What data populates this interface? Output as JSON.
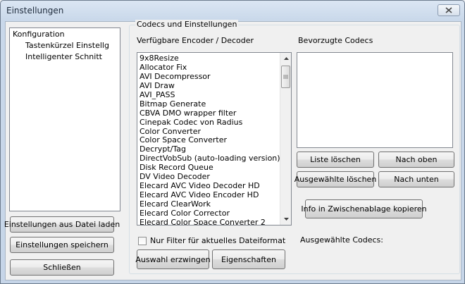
{
  "window": {
    "title": "Einstellungen"
  },
  "icons": {
    "close": "close-icon",
    "scroll_up": "arrow-up-icon",
    "scroll_down": "arrow-down-icon",
    "grip": "scroll-grip-icon"
  },
  "sidebar": {
    "items": [
      {
        "label": "Konfiguration",
        "level": 0
      },
      {
        "label": "Tastenkürzel Einstellg",
        "level": 1
      },
      {
        "label": "Intelligenter Schnitt",
        "level": 1
      }
    ],
    "load_button": "Einstellungen aus Datei laden",
    "save_button": "Einstellungen speichern",
    "close_button": "Schließen"
  },
  "codecs": {
    "group_title": "Codecs und Einstellungen",
    "available_label": "Verfügbare Encoder / Decoder",
    "preferred_label": "Bevorzugte Codecs",
    "available": [
      "9x8Resize",
      "Allocator Fix",
      "AVI Decompressor",
      "AVI Draw",
      "AVI_PASS",
      "Bitmap Generate",
      "CBVA DMO wrapper filter",
      "Cinepak Codec von Radius",
      "Color Converter",
      "Color Space Converter",
      "Decrypt/Tag",
      "DirectVobSub (auto-loading version)",
      "Disk Record Queue",
      "DV Video Decoder",
      "Elecard AVC Video Decoder HD",
      "Elecard AVC Video Encoder HD",
      "Elecard ClearWork",
      "Elecard Color Corrector",
      "Elecard Color Space Converter 2"
    ],
    "preferred": [],
    "clear_list_button": "Liste löschen",
    "move_up_button": "Nach oben",
    "delete_selected_button": "Ausgewählte löschen",
    "move_down_button": "Nach unten",
    "copy_clipboard_button": "Info in Zwischenablage kopieren",
    "filter_checkbox_label": "Nur Filter für aktuelles Dateiformat",
    "filter_checked": false,
    "force_selection_button": "Auswahl erzwingen",
    "properties_button": "Eigenschaften",
    "selected_codecs_label": "Ausgewählte Codecs:"
  }
}
